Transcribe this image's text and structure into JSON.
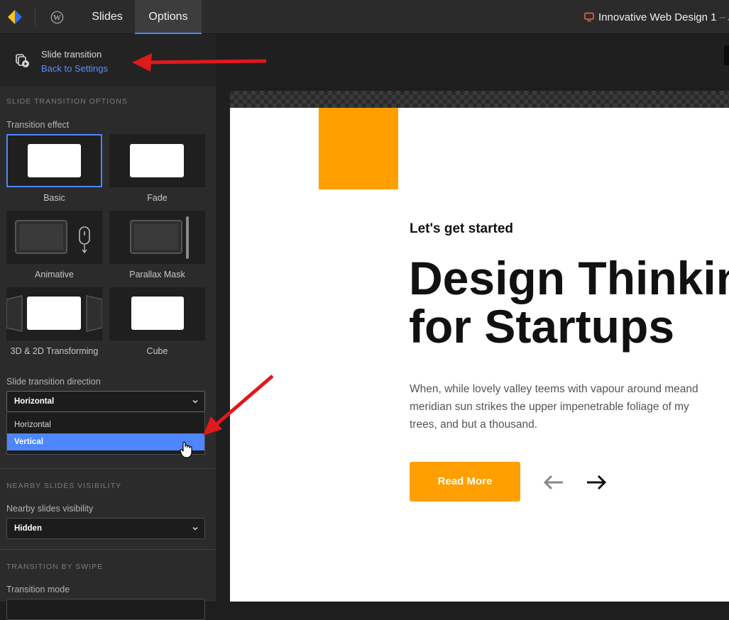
{
  "topbar": {
    "tabs": [
      {
        "label": "Slides"
      },
      {
        "label": "Options"
      }
    ],
    "project_title": "Innovative Web Design 1",
    "project_sub": "– A",
    "accent_color": "#4d86ff"
  },
  "sidebar": {
    "header_title": "Slide transition",
    "back_link": "Back to Settings",
    "section_transition_options": "SLIDE TRANSITION OPTIONS",
    "transition_effect_label": "Transition effect",
    "effects": [
      {
        "name": "Basic",
        "selected": true
      },
      {
        "name": "Fade",
        "selected": false
      },
      {
        "name": "Animative",
        "selected": false
      },
      {
        "name": "Parallax Mask",
        "selected": false
      },
      {
        "name": "3D & 2D Transforming",
        "selected": false
      },
      {
        "name": "Cube",
        "selected": false
      }
    ],
    "direction_label": "Slide transition direction",
    "direction_value": "Horizontal",
    "direction_options": [
      "Horizontal",
      "Vertical"
    ],
    "direction_hovered": "Vertical",
    "section_nearby": "NEARBY SLIDES VISIBILITY",
    "nearby_label": "Nearby slides visibility",
    "nearby_value": "Hidden",
    "section_swipe": "TRANSITION BY SWIPE",
    "transition_mode_label": "Transition mode"
  },
  "slide": {
    "subtitle": "Let's get started",
    "title_line1": "Design Thinkin",
    "title_line2": "for Startups",
    "body": "When, while lovely valley teems with vapour around meand meridian sun strikes the upper impenetrable foliage of my trees, and but a thousand.",
    "button_label": "Read More",
    "brand_color": "#ff9f00"
  },
  "annotations": {
    "arrow_color": "#e0191b"
  }
}
